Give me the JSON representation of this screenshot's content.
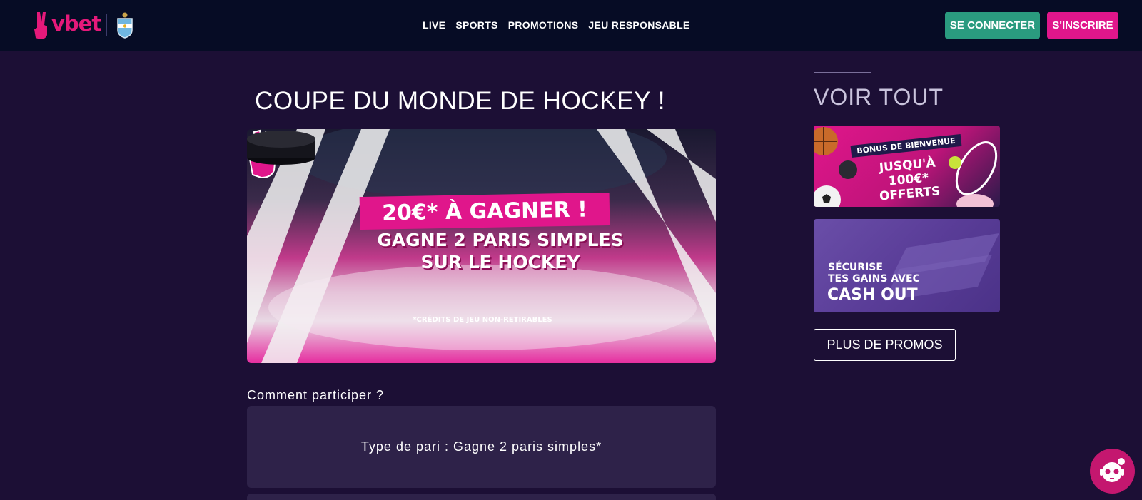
{
  "header": {
    "logo_text": "vbet",
    "nav": [
      "LIVE",
      "SPORTS",
      "PROMOTIONS",
      "JEU RESPONSABLE"
    ],
    "login_label": "SE CONNECTER",
    "signup_label": "S'INSCRIRE"
  },
  "main": {
    "title": "COUPE DU MONDE DE HOCKEY !",
    "hero": {
      "headline": "20€* À GAGNER !",
      "subline_1": "GAGNE 2 PARIS SIMPLES",
      "subline_2": "SUR LE HOCKEY",
      "note": "*CRÉDITS DE JEU NON-RETIRABLES"
    },
    "how_label": "Comment participer ?",
    "card_text": "Type de pari :  Gagne 2 paris simples*"
  },
  "sidebar": {
    "title": "VOIR TOUT",
    "promo1": {
      "badge": "BONUS DE BIENVENUE",
      "line1": "JUSQU'À 100€*",
      "line2": "OFFERTS"
    },
    "promo2": {
      "line1": "SÉCURISE",
      "line2": "TES GAINS AVEC",
      "line3": "CASH OUT"
    },
    "more_label": "PLUS DE PROMOS"
  },
  "colors": {
    "background": "#1c0f35",
    "header": "#060c25",
    "brand_pink": "#e0168b",
    "login_green": "#2a9b7f",
    "card": "#2e2249"
  },
  "icons": [
    "vbet-hand-logo-icon",
    "argentina-crest-icon",
    "chat-robot-icon"
  ]
}
